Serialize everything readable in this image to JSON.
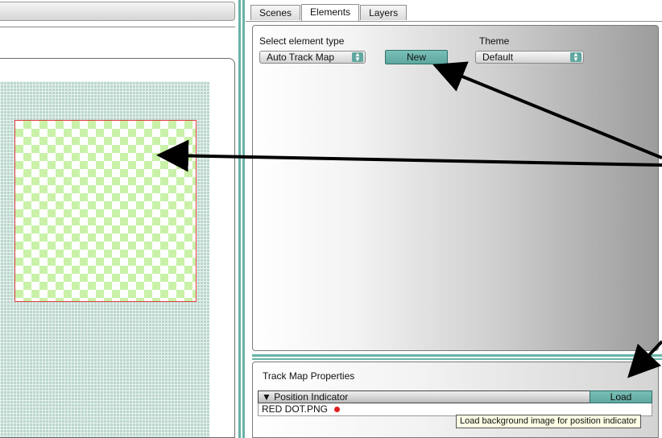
{
  "tabs": [
    {
      "label": "Scenes"
    },
    {
      "label": "Elements"
    },
    {
      "label": "Layers"
    }
  ],
  "active_tab": "Elements",
  "elements_panel": {
    "select_element_type_label": "Select element type",
    "element_type_value": "Auto Track Map",
    "new_button_label": "New",
    "theme_label": "Theme",
    "theme_value": "Default"
  },
  "track_map_properties": {
    "title": "Track Map Properties",
    "section_label": "▼ Position Indicator",
    "load_button_label": "Load",
    "file_name": "RED DOT.PNG",
    "dot_color": "#e02020"
  },
  "tooltip": {
    "text": "Load background image for position indicator"
  },
  "colors": {
    "accent": "#67b3a7",
    "button": "#6cb3aa",
    "element_border": "#e04040",
    "checker": "#c9f2a8"
  }
}
